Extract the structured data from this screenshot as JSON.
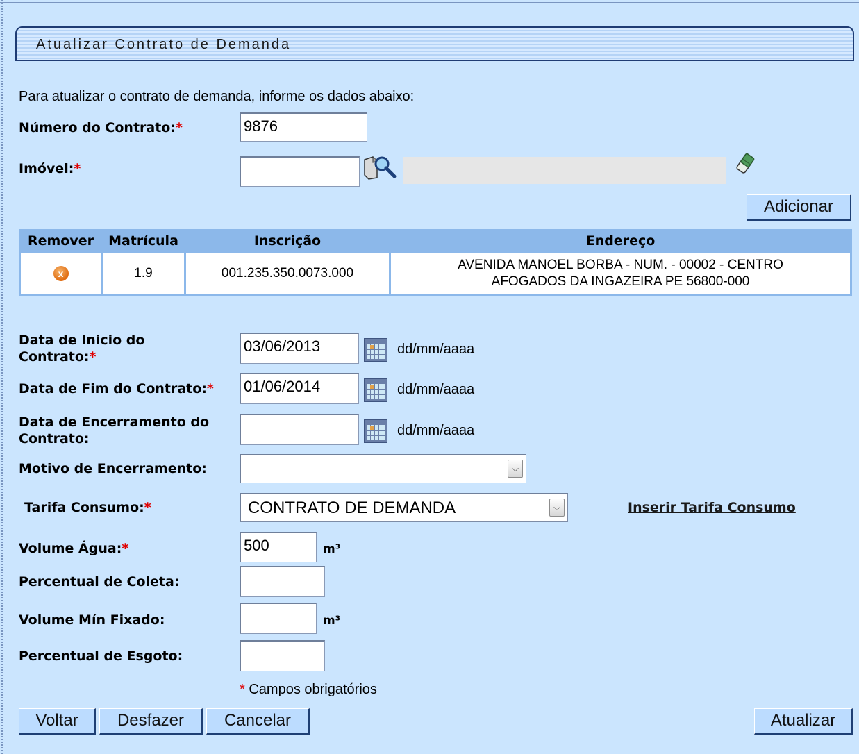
{
  "page": {
    "title": "Atualizar Contrato de Demanda",
    "intro": "Para atualizar o contrato de demanda, informe os dados abaixo:"
  },
  "form": {
    "numero_contrato": {
      "label": "Número do Contrato:",
      "required": "*",
      "value": "9876"
    },
    "imovel": {
      "label": "Imóvel:",
      "required": "*",
      "value": ""
    },
    "add_button": "Adicionar",
    "data_inicio": {
      "label_line1": "Data de Inicio do",
      "label_line2": "Contrato:",
      "required": "*",
      "value": "03/06/2013",
      "hint": "dd/mm/aaaa"
    },
    "data_fim": {
      "label": "Data de Fim do Contrato:",
      "required": "*",
      "value": "01/06/2014",
      "hint": "dd/mm/aaaa"
    },
    "data_encerramento": {
      "label_line1": "Data de Encerramento do",
      "label_line2": "Contrato:",
      "value": "",
      "hint": "dd/mm/aaaa"
    },
    "motivo_encerramento": {
      "label": "Motivo de Encerramento:",
      "value": ""
    },
    "tarifa_consumo": {
      "label": "Tarifa Consumo:",
      "required": "*",
      "value": "CONTRATO DE DEMANDA",
      "link": "Inserir Tarifa Consumo"
    },
    "volume_agua": {
      "label": "Volume Água:",
      "required": "*",
      "value": "500",
      "unit": "m³"
    },
    "percentual_coleta": {
      "label": "Percentual de Coleta:",
      "value": ""
    },
    "volume_min": {
      "label": "Volume Mín Fixado:",
      "value": "",
      "unit": "m³"
    },
    "percentual_esgoto": {
      "label": "Percentual de Esgoto:",
      "value": ""
    },
    "required_note_star": "*",
    "required_note": "Campos obrigatórios"
  },
  "table": {
    "headers": [
      "Remover",
      "Matrícula",
      "Inscrição",
      "Endereço"
    ],
    "rows": [
      {
        "remove_icon": "x",
        "matricula": "1.9",
        "inscricao": "001.235.350.0073.000",
        "endereco_line1": "AVENIDA MANOEL BORBA - NUM. - 00002 - CENTRO",
        "endereco_line2": "AFOGADOS DA INGAZEIRA PE 56800-000"
      }
    ]
  },
  "buttons": {
    "voltar": "Voltar",
    "desfazer": "Desfazer",
    "cancelar": "Cancelar",
    "atualizar": "Atualizar"
  },
  "icons": {
    "search": "search-icon",
    "eraser": "eraser-icon",
    "calendar": "calendar-icon",
    "remove": "remove-icon"
  }
}
